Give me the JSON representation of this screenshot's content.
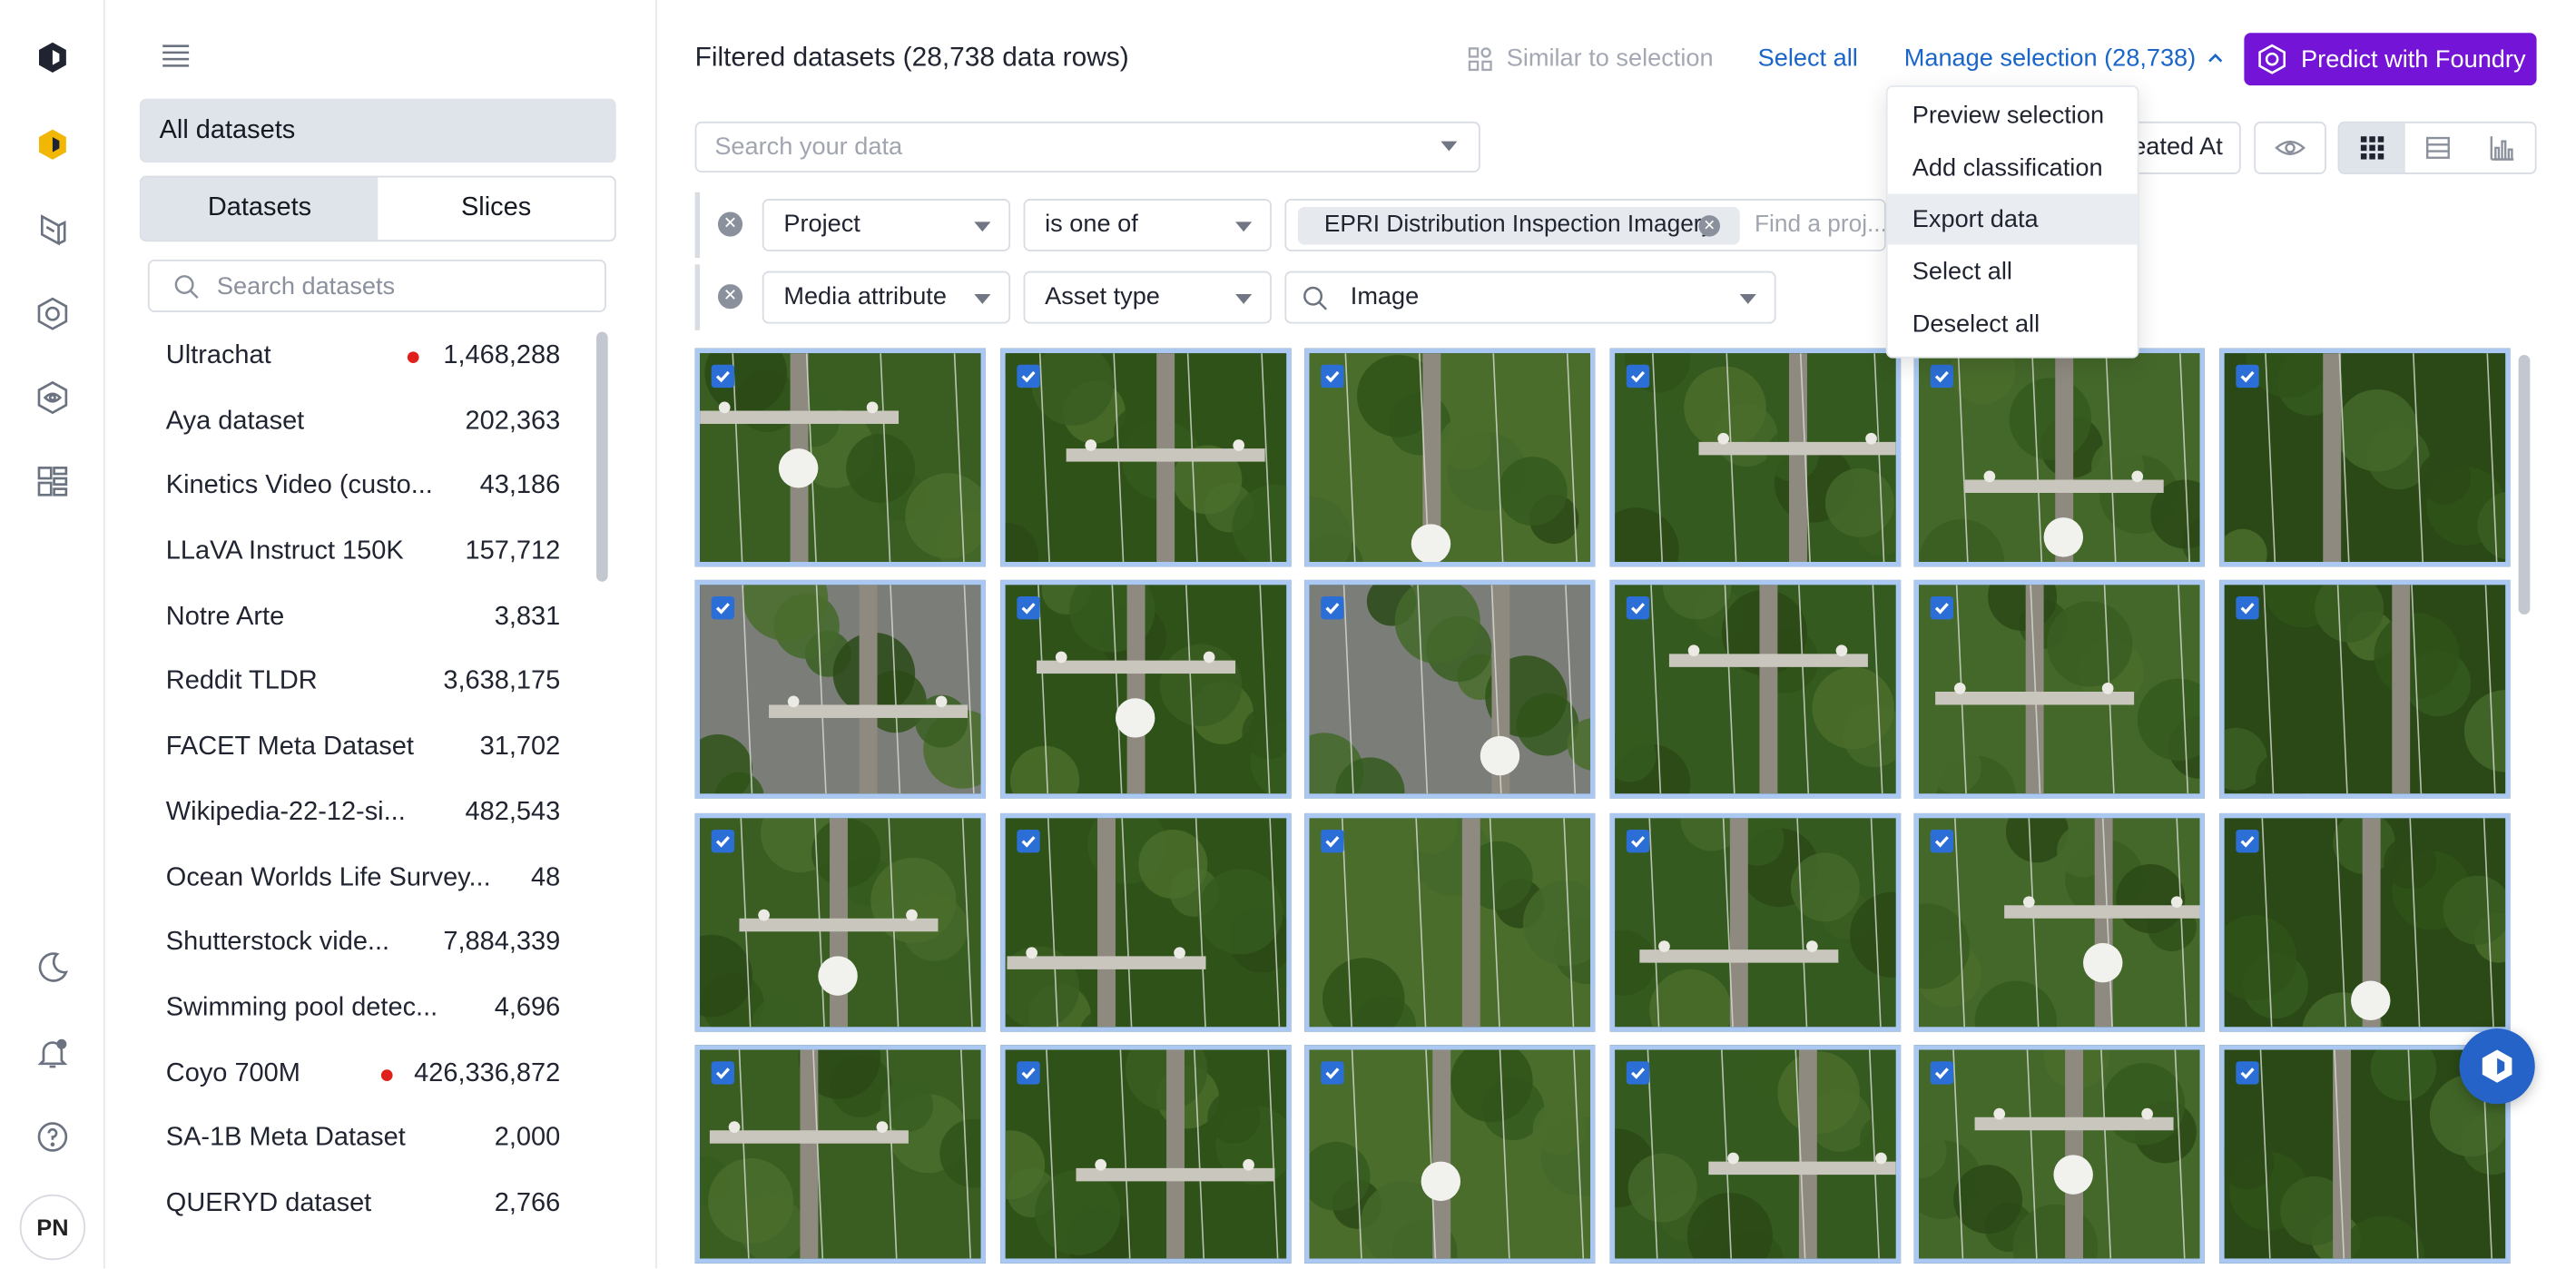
{
  "user": {
    "initials": "PN"
  },
  "sidebar": {
    "all_datasets_label": "All datasets",
    "tabs": [
      {
        "label": "Datasets",
        "active": true
      },
      {
        "label": "Slices",
        "active": false
      }
    ],
    "search_placeholder": "Search datasets",
    "datasets": [
      {
        "name": "Ultrachat",
        "count": "1,468,288",
        "alert": true
      },
      {
        "name": "Aya dataset",
        "count": "202,363",
        "alert": false
      },
      {
        "name": "Kinetics Video (custo...",
        "count": "43,186",
        "alert": false
      },
      {
        "name": "LLaVA Instruct 150K",
        "count": "157,712",
        "alert": false
      },
      {
        "name": "Notre Arte",
        "count": "3,831",
        "alert": false
      },
      {
        "name": "Reddit TLDR",
        "count": "3,638,175",
        "alert": false
      },
      {
        "name": "FACET Meta Dataset",
        "count": "31,702",
        "alert": false
      },
      {
        "name": "Wikipedia-22-12-si...",
        "count": "482,543",
        "alert": false
      },
      {
        "name": "Ocean Worlds Life Survey...",
        "count": "48",
        "alert": false
      },
      {
        "name": "Shutterstock vide...",
        "count": "7,884,339",
        "alert": false
      },
      {
        "name": "Swimming pool detec...",
        "count": "4,696",
        "alert": false
      },
      {
        "name": "Coyo 700M",
        "count": "426,336,872",
        "alert": true
      },
      {
        "name": "SA-1B Meta Dataset",
        "count": "2,000",
        "alert": false
      },
      {
        "name": "QUERYD dataset",
        "count": "2,766",
        "alert": false
      }
    ]
  },
  "header": {
    "title": "Filtered datasets (28,738 data rows)",
    "similar_label": "Similar to selection",
    "select_all_label": "Select all",
    "manage_label": "Manage selection (28,738)",
    "predict_label": "Predict with Foundry"
  },
  "search": {
    "placeholder": "Search your data"
  },
  "sort": {
    "label": "eated At"
  },
  "filters": [
    {
      "field": "Project",
      "operator": "is one of",
      "chip": "EPRI Distribution Inspection Imagery",
      "find_placeholder": "Find a proj..."
    },
    {
      "field": "Media attribute",
      "operator": "Asset type",
      "value": "Image"
    }
  ],
  "manage_menu": {
    "items": [
      "Preview selection",
      "Add classification",
      "Export data",
      "Select all",
      "Deselect all"
    ],
    "highlighted": "Export data"
  },
  "colors": {
    "accent": "#1965c9",
    "predict": "#7414d7",
    "selected_border": "#aac8f2",
    "alert_dot": "#e0201b"
  },
  "grid": {
    "rows": 4,
    "cols": 6,
    "all_selected": true
  }
}
